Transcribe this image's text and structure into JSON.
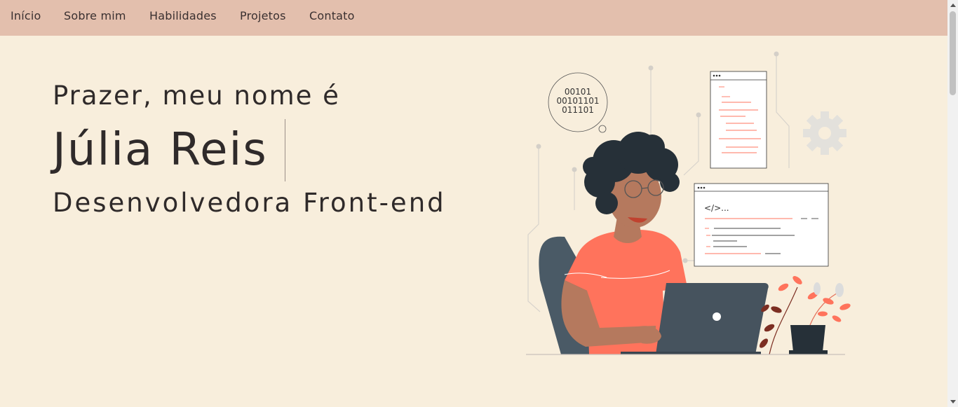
{
  "nav": {
    "items": [
      "Início",
      "Sobre mim",
      "Habilidades",
      "Projetos",
      "Contato"
    ]
  },
  "hero": {
    "greeting": "Prazer, meu nome é",
    "name": "Júlia Reis",
    "role": "Desenvolvedora Front-end"
  },
  "illustration": {
    "binary_lines": [
      "00101",
      "00101101",
      "011101"
    ],
    "code_snippet": "</>..."
  },
  "colors": {
    "nav_bg": "#e3bfad",
    "page_bg": "#f8eedc",
    "accent": "#ff735c",
    "dark": "#2f3a45"
  }
}
